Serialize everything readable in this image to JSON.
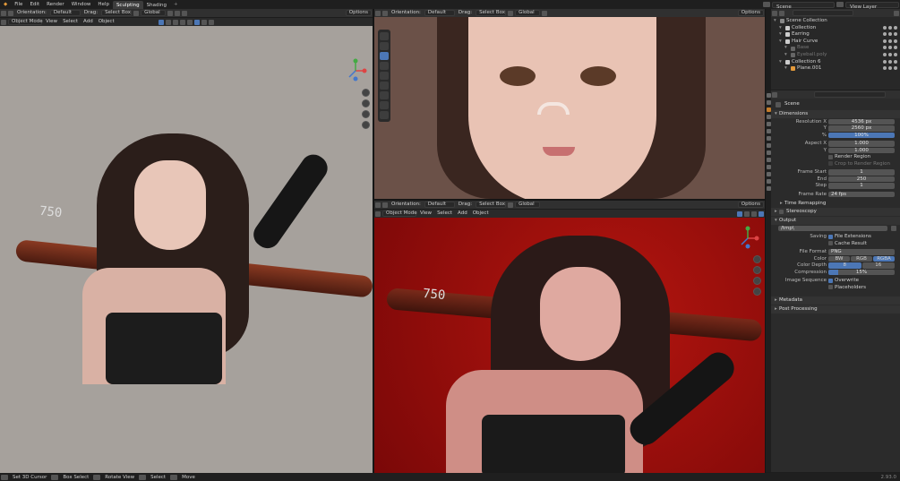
{
  "menubar": {
    "items": [
      "File",
      "Edit",
      "Render",
      "Window",
      "Help"
    ],
    "tabs": [
      {
        "label": "Sculpting",
        "active": true
      },
      {
        "label": "Shading",
        "active": false
      }
    ],
    "tab_close": "+",
    "scene_label": "Scene",
    "view_layer_label": "View Layer"
  },
  "viewport_header": {
    "orientation_label": "Orientation:",
    "orientation_value": "Default",
    "drag_label": "Drag:",
    "drag_value": "Select Box",
    "transform_value": "Global",
    "options_label": "Options",
    "mode_value": "Object Mode",
    "menus": [
      "View",
      "Select",
      "Add",
      "Object"
    ]
  },
  "viewports": {
    "left": {
      "background": "#a6a19c"
    },
    "top_right": {
      "background": "#6b5148"
    },
    "bottom_right": {
      "background": "#a10d0d"
    }
  },
  "bat_text": "750",
  "outliner": {
    "search_placeholder": "",
    "rows": [
      {
        "label": "Scene Collection",
        "indent": 0,
        "icon_color": "#888888",
        "dim": false
      },
      {
        "label": "Collection",
        "indent": 1,
        "icon_color": "#cccccc",
        "dim": false
      },
      {
        "label": "Earring",
        "indent": 1,
        "icon_color": "#cccccc",
        "dim": false
      },
      {
        "label": "Hair Curve",
        "indent": 1,
        "icon_color": "#cccccc",
        "dim": false
      },
      {
        "label": "Base",
        "indent": 2,
        "icon_color": "#666666",
        "dim": true
      },
      {
        "label": "Eyeball.poly",
        "indent": 2,
        "icon_color": "#666666",
        "dim": true
      },
      {
        "label": "Collection 6",
        "indent": 1,
        "icon_color": "#cccccc",
        "dim": false
      },
      {
        "label": "Plane.001",
        "indent": 2,
        "icon_color": "#e49a3b",
        "dim": false
      }
    ]
  },
  "properties": {
    "search_placeholder": "",
    "scene_name": "Scene",
    "dimensions": {
      "title": "Dimensions",
      "resolution_x_label": "Resolution X",
      "resolution_x": "4536 px",
      "y_label": "Y",
      "resolution_y": "2560 px",
      "percent_label": "%",
      "percent": "100%",
      "aspect_x_label": "Aspect X",
      "aspect_x": "1.000",
      "aspect_y": "1.000",
      "render_region": "Render Region",
      "crop_region": "Crop to Render Region",
      "frame_start_label": "Frame Start",
      "frame_start": "1",
      "end_label": "End",
      "frame_end": "250",
      "step_label": "Step",
      "step": "1",
      "frame_rate_label": "Frame Rate",
      "frame_rate": "24 fps",
      "time_remapping": "Time Remapping",
      "stereoscopy": "Stereoscopy"
    },
    "output": {
      "title": "Output",
      "path": "/tmp\\",
      "saving_label": "Saving",
      "file_extensions": "File Extensions",
      "cache_result": "Cache Result",
      "file_format_label": "File Format",
      "file_format": "PNG",
      "color_label": "Color",
      "color_options": [
        {
          "label": "BW",
          "on": false
        },
        {
          "label": "RGB",
          "on": false
        },
        {
          "label": "RGBA",
          "on": true
        }
      ],
      "color_depth_label": "Color Depth",
      "color_depth_options": [
        {
          "label": "8",
          "on": true
        },
        {
          "label": "16",
          "on": false
        }
      ],
      "compression_label": "Compression",
      "compression": "15%",
      "image_sequence_label": "Image Sequence",
      "overwrite": "Overwrite",
      "placeholders": "Placeholders"
    },
    "metadata": "Metadata",
    "post_processing": "Post Processing"
  },
  "statusbar": {
    "items": [
      "Set 3D Cursor",
      "Box Select",
      "Rotate View",
      "Select",
      "Move"
    ],
    "version": "2.93.0"
  },
  "colors": {
    "accent_blue": "#4c77b6",
    "active_orange": "#e49a3b"
  }
}
